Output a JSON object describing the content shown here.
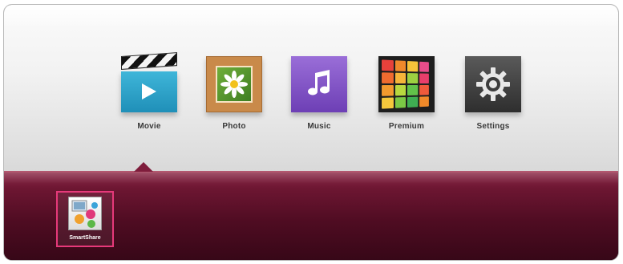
{
  "main_menu": {
    "items": [
      {
        "id": "movie",
        "label": "Movie",
        "icon": "movie-clapperboard-icon",
        "color": "#2a9ec8"
      },
      {
        "id": "photo",
        "label": "Photo",
        "icon": "photo-frame-icon",
        "color": "#c98a4a"
      },
      {
        "id": "music",
        "label": "Music",
        "icon": "music-note-icon",
        "color": "#7a4cc4"
      },
      {
        "id": "premium",
        "label": "Premium",
        "icon": "premium-grid-icon",
        "color": "#1e1e1e"
      },
      {
        "id": "settings",
        "label": "Settings",
        "icon": "gear-icon",
        "color": "#3c3c3c"
      }
    ],
    "selected": "Movie"
  },
  "sub_menu": {
    "items": [
      {
        "id": "smartshare",
        "label": "SmartShare",
        "icon": "smartshare-icon",
        "selected": true
      }
    ],
    "accent_color": "#e6397a",
    "panel_color": "#5a0f28"
  }
}
